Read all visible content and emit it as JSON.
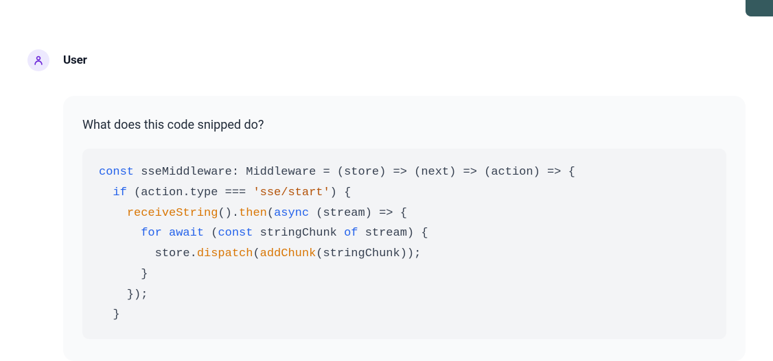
{
  "header": {
    "username": "User",
    "avatar_icon": "user-icon"
  },
  "content": {
    "question": "What does this code snipped do?"
  },
  "code": {
    "tokens": [
      {
        "cls": "tok-kw",
        "t": "const"
      },
      {
        "cls": "",
        "t": " sseMiddleware"
      },
      {
        "cls": "tok-op",
        "t": ":"
      },
      {
        "cls": "",
        "t": " "
      },
      {
        "cls": "tok-type",
        "t": "Middleware"
      },
      {
        "cls": "",
        "t": " "
      },
      {
        "cls": "tok-op",
        "t": "="
      },
      {
        "cls": "",
        "t": " (store) "
      },
      {
        "cls": "tok-op",
        "t": "=>"
      },
      {
        "cls": "",
        "t": " (next) "
      },
      {
        "cls": "tok-op",
        "t": "=>"
      },
      {
        "cls": "",
        "t": " (action) "
      },
      {
        "cls": "tok-op",
        "t": "=>"
      },
      {
        "cls": "",
        "t": " {"
      },
      {
        "cls": "nl",
        "t": "\n"
      },
      {
        "cls": "",
        "t": "  "
      },
      {
        "cls": "tok-kw",
        "t": "if"
      },
      {
        "cls": "",
        "t": " (action.type "
      },
      {
        "cls": "tok-op",
        "t": "==="
      },
      {
        "cls": "",
        "t": " "
      },
      {
        "cls": "tok-str",
        "t": "'sse/start'"
      },
      {
        "cls": "",
        "t": ") {"
      },
      {
        "cls": "nl",
        "t": "\n"
      },
      {
        "cls": "",
        "t": "    "
      },
      {
        "cls": "tok-fn",
        "t": "receiveString"
      },
      {
        "cls": "",
        "t": "()."
      },
      {
        "cls": "tok-fn",
        "t": "then"
      },
      {
        "cls": "",
        "t": "("
      },
      {
        "cls": "tok-kw",
        "t": "async"
      },
      {
        "cls": "",
        "t": " (stream) "
      },
      {
        "cls": "tok-op",
        "t": "=>"
      },
      {
        "cls": "",
        "t": " {"
      },
      {
        "cls": "nl",
        "t": "\n"
      },
      {
        "cls": "",
        "t": "      "
      },
      {
        "cls": "tok-kw",
        "t": "for await"
      },
      {
        "cls": "",
        "t": " ("
      },
      {
        "cls": "tok-kw",
        "t": "const"
      },
      {
        "cls": "",
        "t": " stringChunk "
      },
      {
        "cls": "tok-kw",
        "t": "of"
      },
      {
        "cls": "",
        "t": " stream) {"
      },
      {
        "cls": "nl",
        "t": "\n"
      },
      {
        "cls": "",
        "t": "        store."
      },
      {
        "cls": "tok-fn",
        "t": "dispatch"
      },
      {
        "cls": "",
        "t": "("
      },
      {
        "cls": "tok-fn",
        "t": "addChunk"
      },
      {
        "cls": "",
        "t": "(stringChunk));"
      },
      {
        "cls": "nl",
        "t": "\n"
      },
      {
        "cls": "",
        "t": "      }"
      },
      {
        "cls": "nl",
        "t": "\n"
      },
      {
        "cls": "",
        "t": "    });"
      },
      {
        "cls": "nl",
        "t": "\n"
      },
      {
        "cls": "",
        "t": "  }"
      }
    ]
  }
}
